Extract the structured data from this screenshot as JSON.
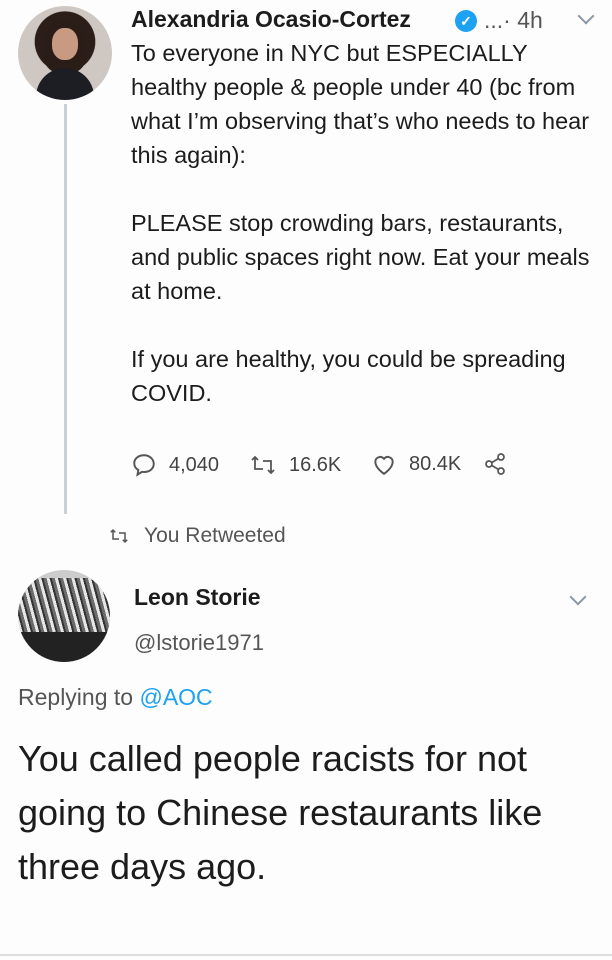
{
  "tweet": {
    "author_name": "Alexandria Ocasio-Cortez",
    "timestamp": "4h",
    "more_glyph": "...·",
    "paragraphs": [
      "To everyone in NYC but ESPECIALLY healthy people & people under 40 (bc from what I’m observing that’s who needs to hear this again):",
      "PLEASE stop crowding bars, restaurants, and public spaces right now. Eat your meals at home.",
      "If you are healthy, you could be spreading COVID."
    ],
    "stats": {
      "replies": "4,040",
      "retweets": "16.6K",
      "likes": "80.4K"
    },
    "icons": [
      "reply-icon",
      "retweet-icon",
      "like-icon",
      "share-icon",
      "verified-icon",
      "chevron-down-icon"
    ]
  },
  "retweet_notice": {
    "label": "You Retweeted"
  },
  "reply": {
    "author_name": "Leon Storie",
    "handle": "@lstorie1971",
    "replying_prefix": "Replying to",
    "replying_mention": "@AOC",
    "text": "You called people racists for not going to Chinese restaurants like three days ago."
  },
  "colors": {
    "accent": "#1da1f2",
    "text": "#1c1c1c",
    "muted": "#555555",
    "thread_line": "#c9d0d6"
  }
}
